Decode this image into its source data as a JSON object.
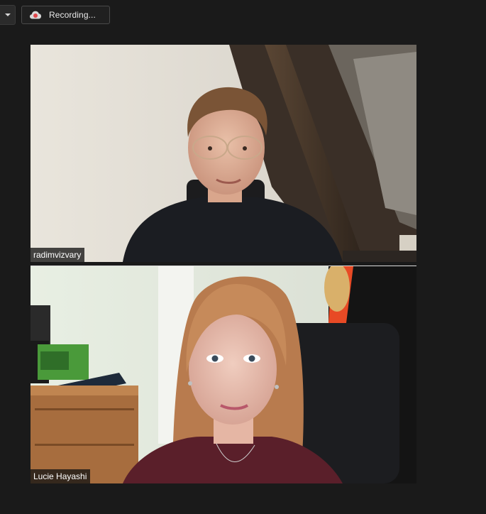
{
  "toolbar": {
    "recording_label": "Recording..."
  },
  "participants": [
    {
      "name": "radimvizvary"
    },
    {
      "name": "Lucie Hayashi"
    }
  ],
  "icons": {
    "dropdown": "chevron-down-icon",
    "recording": "cloud-recording-icon"
  },
  "colors": {
    "background": "#1a1a1a",
    "recording_accent": "#e0474c"
  }
}
